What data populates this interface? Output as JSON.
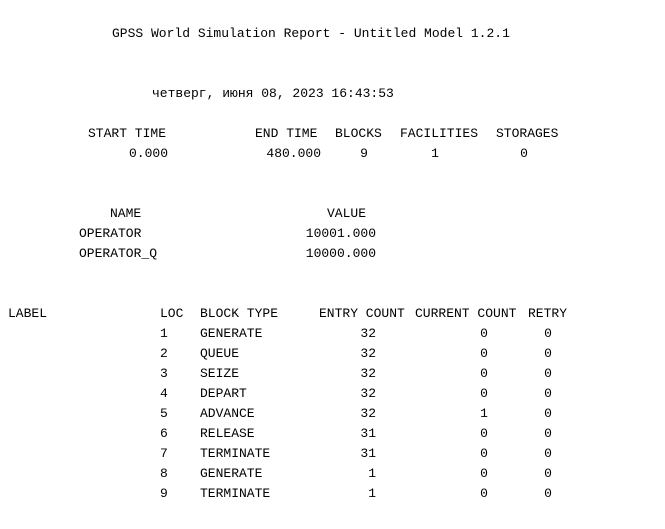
{
  "report": {
    "title": "GPSS World Simulation Report - Untitled Model 1.2.1",
    "datetime": "четверг, июня 08, 2023 16:43:53"
  },
  "summary": {
    "headers": [
      "START TIME",
      "END TIME",
      "BLOCKS",
      "FACILITIES",
      "STORAGES"
    ],
    "values": [
      "0.000",
      "480.000",
      "9",
      "1",
      "0"
    ]
  },
  "names": {
    "headers": [
      "NAME",
      "VALUE"
    ],
    "rows": [
      {
        "name": "OPERATOR",
        "value": "10001.000"
      },
      {
        "name": "OPERATOR_Q",
        "value": "10000.000"
      }
    ]
  },
  "blocks": {
    "headers": [
      "LABEL",
      "LOC",
      "BLOCK TYPE",
      "ENTRY COUNT",
      "CURRENT COUNT",
      "RETRY"
    ],
    "rows": [
      {
        "loc": "1",
        "type": "GENERATE",
        "entry": "32",
        "current": "0",
        "retry": "0"
      },
      {
        "loc": "2",
        "type": "QUEUE",
        "entry": "32",
        "current": "0",
        "retry": "0"
      },
      {
        "loc": "3",
        "type": "SEIZE",
        "entry": "32",
        "current": "0",
        "retry": "0"
      },
      {
        "loc": "4",
        "type": "DEPART",
        "entry": "32",
        "current": "0",
        "retry": "0"
      },
      {
        "loc": "5",
        "type": "ADVANCE",
        "entry": "32",
        "current": "1",
        "retry": "0"
      },
      {
        "loc": "6",
        "type": "RELEASE",
        "entry": "31",
        "current": "0",
        "retry": "0"
      },
      {
        "loc": "7",
        "type": "TERMINATE",
        "entry": "31",
        "current": "0",
        "retry": "0"
      },
      {
        "loc": "8",
        "type": "GENERATE",
        "entry": "1",
        "current": "0",
        "retry": "0"
      },
      {
        "loc": "9",
        "type": "TERMINATE",
        "entry": "1",
        "current": "0",
        "retry": "0"
      }
    ]
  }
}
